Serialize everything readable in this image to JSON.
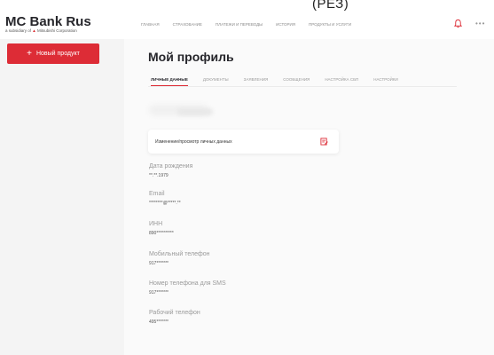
{
  "caption": "(РЕЗ)",
  "brand": {
    "name": "MC Bank Rus",
    "subtitle_prefix": "a subsidiary of ",
    "subtitle_mark": "▲",
    "subtitle_company": " Mitsubishi Corporation"
  },
  "nav": [
    "ГЛАВНАЯ",
    "СТРАХОВАНИЕ",
    "ПЛАТЕЖИ И ПЕРЕВОДЫ",
    "ИСТОРИЯ",
    "ПРОДУКТЫ И УСЛУГИ"
  ],
  "header_icons": {
    "notifications": "bell-icon",
    "more": "more-icon",
    "more_glyph": "•••"
  },
  "sidebar": {
    "new_product": "Новый продукт",
    "plus": "+"
  },
  "page_title": "Мой профиль",
  "tabs": [
    "ЛИЧНЫЕ ДАННЫЕ",
    "ДОКУМЕНТЫ",
    "ЗАЯВЛЕНИЯ",
    "СООБЩЕНИЯ",
    "НАСТРОЙКА СБП",
    "НАСТРОЙКИ"
  ],
  "active_tab": "ЛИЧНЫЕ ДАННЫЕ",
  "edit_card": {
    "label": "Изменение/просмотр личных данных",
    "icon": "edit-document-icon"
  },
  "fields": [
    {
      "label": "Дата рождения",
      "value": "**.**.1979"
    },
    {
      "label": "Email",
      "value": "********@*****.**"
    },
    {
      "label": "ИНН",
      "value": "890**********"
    },
    {
      "label": "Мобильный телефон",
      "value": "917*******"
    },
    {
      "label": "Номер телефона для SMS",
      "value": "917*******"
    },
    {
      "label": "Рабочий телефон",
      "value": "495*******"
    }
  ],
  "colors": {
    "accent": "#dd2c36",
    "title": "#26262b",
    "muted": "#9a9a9a"
  }
}
